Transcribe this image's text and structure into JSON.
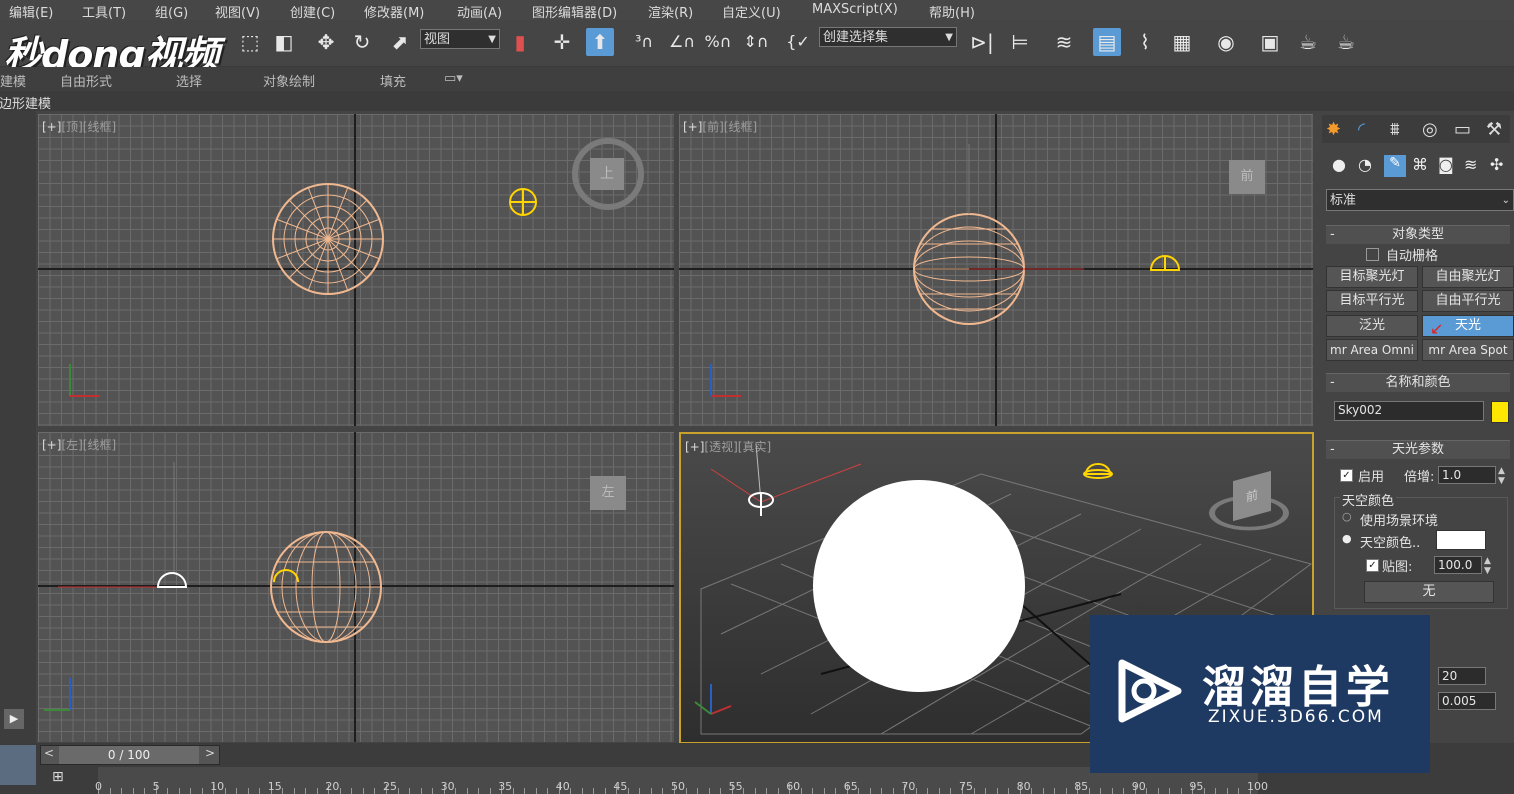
{
  "menu": [
    "编辑(E)",
    "工具(T)",
    "组(G)",
    "视图(V)",
    "创建(C)",
    "修改器(M)",
    "动画(A)",
    "图形编辑器(D)",
    "渲染(R)",
    "自定义(U)",
    "MAXScript(X)",
    "帮助(H)"
  ],
  "logo": {
    "text": "秒dong视频"
  },
  "toolbar": {
    "view_select": "视图",
    "selection_set": "创建选择集",
    "icons": [
      "select-region-icon",
      "move-icon",
      "rotate-icon",
      "scale-icon",
      "link-icon",
      "pivot-icon",
      "manipulate-icon",
      "snap-3d-icon",
      "angle-snap-icon",
      "percent-snap-icon",
      "spinner-snap-icon",
      "named-selection-icon",
      "mirror-icon",
      "align-icon",
      "layers-icon",
      "scene-explorer-icon",
      "curve-editor-icon",
      "schematic-icon",
      "material-editor-icon",
      "render-setup-icon",
      "render-frame-icon",
      "render-icon"
    ]
  },
  "ribbon": {
    "left_cut": "建模",
    "tabs": [
      "自由形式",
      "选择",
      "对象绘制",
      "填充"
    ],
    "sub": "多边形建模"
  },
  "viewports": {
    "top": {
      "plus": "[+]",
      "view": "[顶]",
      "mode": "[线框]"
    },
    "front": {
      "plus": "[+]",
      "view": "[前]",
      "mode": "[线框]"
    },
    "left": {
      "plus": "[+]",
      "view": "[左]",
      "mode": "[线框]"
    },
    "persp": {
      "plus": "[+]",
      "view": "[透视]",
      "mode": "[真实]"
    }
  },
  "viewcube": {
    "top": "上",
    "front": "前",
    "left": "左",
    "persp": "前"
  },
  "command_panel": {
    "tabs_icons": [
      "create-icon",
      "modify-icon",
      "hierarchy-icon",
      "motion-icon",
      "display-icon",
      "utilities-icon"
    ],
    "category_icons": [
      "geometry-icon",
      "shapes-icon",
      "lights-icon",
      "cameras-icon",
      "helpers-icon",
      "spacewarps-icon",
      "systems-icon"
    ],
    "dropdown": "标准",
    "rollout_object_type": {
      "title": "对象类型",
      "autogrid_label": "自动栅格",
      "buttons": [
        "目标聚光灯",
        "自由聚光灯",
        "目标平行光",
        "自由平行光",
        "泛光",
        "天光",
        "mr Area Omni",
        "mr Area Spot"
      ],
      "selected_index": 5
    },
    "rollout_name_color": {
      "title": "名称和颜色",
      "name": "Sky002",
      "color": "#ffe600"
    },
    "rollout_skylight": {
      "title": "天光参数",
      "on_label": "启用",
      "multiplier_label": "倍增:",
      "multiplier": "1.0",
      "sky_color_group": "天空颜色",
      "use_scene_env": "使用场景环境",
      "sky_color_label": "天空颜色..",
      "sky_color": "#ffffff",
      "map_label": "贴图:",
      "map_value": "100.0",
      "map_button": "无",
      "rays_value": "20",
      "ray_bias": "0.005"
    }
  },
  "timeline": {
    "frame": "0 / 100",
    "prev": "<",
    "next": ">",
    "labels": [
      "0",
      "5",
      "10",
      "15",
      "20",
      "25",
      "30",
      "35",
      "40",
      "45",
      "50",
      "55",
      "60",
      "65",
      "70",
      "75",
      "80",
      "85",
      "90",
      "95",
      "100"
    ]
  },
  "watermark": {
    "title": "溜溜自学",
    "url": "ZIXUE.3D66.COM"
  }
}
